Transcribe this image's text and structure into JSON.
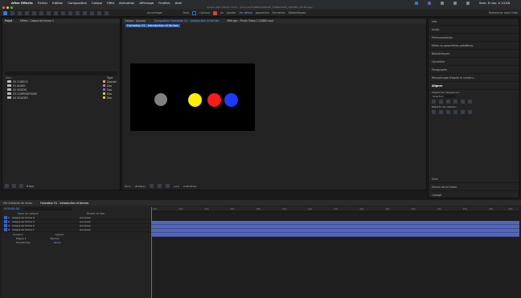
{
  "menubar": {
    "app": "After Effects",
    "items": [
      "Fichier",
      "Edition",
      "Composition",
      "Calque",
      "Effet",
      "Animation",
      "Affichage",
      "Fenêtre",
      "Aide"
    ],
    "clock": "Sam. 6 nov. à 14:58"
  },
  "titlebar": {
    "title": "Adobe After Effects 2022 - /Volumes/FORMATIONS/AE_FORMATION_FORMES_AFTER.aep *"
  },
  "toolbar": {
    "snap_label": "Accrochage",
    "fill_label": "Fond",
    "stroke_label": "Contour",
    "px_label": "px",
    "add_label": "Ajouter",
    "default_label": "Par défaut",
    "learn_label": "Apprendre",
    "formation_label": "Formation",
    "bibliotheques_label": "Bibliothèques",
    "search_placeholder": "Rechercher dans l'aide"
  },
  "project": {
    "tab_label": "Projet",
    "effects_label": "Effets : Calque de forme 1",
    "search_placeholder": "",
    "col_name": "Nom",
    "col_type": "Type",
    "items": [
      {
        "name": "00 CODECS",
        "type": "Dossier",
        "color": "#d6a93a"
      },
      {
        "name": "01 AUDIO",
        "type": "Dos",
        "color": "#e06a9a"
      },
      {
        "name": "02 VIDEOS",
        "type": "Dos",
        "color": "#7b6adb"
      },
      {
        "name": "03 COMPOSITIONS",
        "type": "Dos",
        "color": "#d6c23a"
      },
      {
        "name": "04 SOLIDES",
        "type": "Dos",
        "color": "#d6c23a"
      }
    ],
    "footer_bpc": "8 bpc"
  },
  "comp": {
    "tab_source": "Calque : (aucun)",
    "tab_comp": "Composition Formation 01 - Introduction et formes",
    "tab_footage": "Métrage : Finale Video 1-02880.mp4",
    "breadcrumb": "Formation 01 - Introduction et formes",
    "zoom": "50 %",
    "resolution": "(Entière)",
    "timecode": "0:00:00:00",
    "plus": "+0,0"
  },
  "circles": [
    {
      "color": "#808080"
    },
    {
      "color": "#ffee00"
    },
    {
      "color": "#ff1a1a"
    },
    {
      "color": "#1a3cff"
    }
  ],
  "right_panel": {
    "header": "Info",
    "items": [
      "Audio",
      "Prévisualisation",
      "Effets et paramètres prédéfinis",
      "Bibliothèques",
      "Caractère",
      "Paragraphe",
      "Remplissage d'après le contenu"
    ],
    "align_title": "Aligner",
    "align_to_label": "Aligner les calques sur :",
    "align_to_value": "Sélection",
    "distribute_label": "Répartir les calques :",
    "bottom_items": [
      "Suivi",
      "Dessin de la trame",
      "Lissage"
    ]
  },
  "timeline": {
    "tab_queue": "File d'attente de rendu",
    "tab_comp": "Formation 01 - Introduction et formes",
    "timecode": "0:00:00:00",
    "col_layer_name": "Nom du calque",
    "col_parent": "Parent et lien",
    "layers": [
      {
        "num": "1",
        "name": "Calque de forme 4",
        "parent": "Aucun(e)"
      },
      {
        "num": "2",
        "name": "Calque de forme 3",
        "parent": "Aucun(e)"
      },
      {
        "num": "3",
        "name": "Calque de forme 2",
        "parent": "Aucun(e)"
      },
      {
        "num": "4",
        "name": "Calque de forme 1",
        "parent": "Aucun(e)"
      }
    ],
    "sub_contents": "Contenu",
    "sub_add": "Ajouter",
    "sub_ellipse": "Ellipse 1",
    "sub_mode": "Normal",
    "sub_transform": "Transformer",
    "sub_reset": "Réinit.",
    "ruler": [
      "00s",
      "02s",
      "04s",
      "06s",
      "08s",
      "10s",
      "12s",
      "14s",
      "16s",
      "18s",
      "20s",
      "22s",
      "24s",
      "26s",
      "28s"
    ]
  }
}
